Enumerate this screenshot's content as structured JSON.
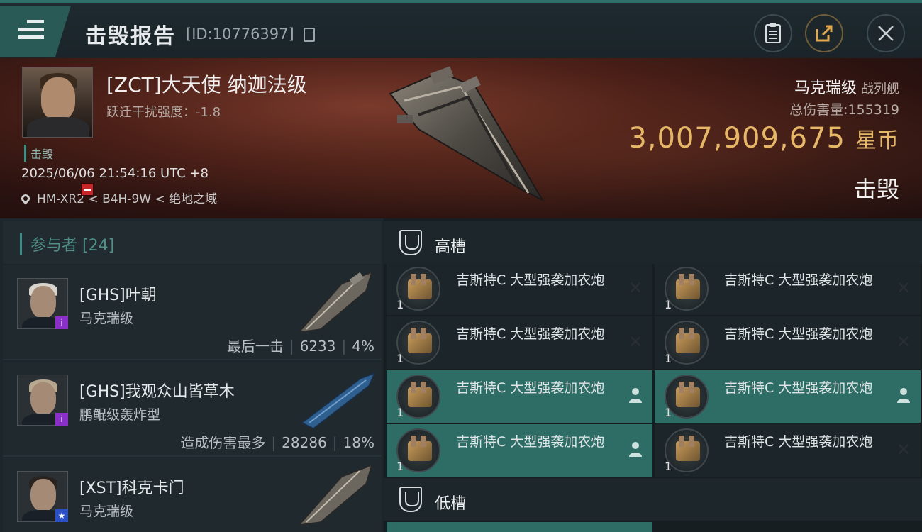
{
  "header": {
    "title": "击毁报告",
    "report_id": "[ID:10776397]"
  },
  "victim": {
    "pilot": "[ZCT]大天使 纳迦法级",
    "warp_strength": "跃迁干扰强度：-1.8",
    "tag": "击毁",
    "datetime": "2025/06/06 21:54:16 UTC +8",
    "location": "HM-XR2 < B4H-9W < 绝地之域",
    "ship_name": "马克瑞级",
    "ship_type": "战列舰",
    "total_damage_label": "总伤害量:",
    "total_damage_value": "155319",
    "isk_value": "3,007,909,675",
    "isk_unit": "星币",
    "status": "击毁"
  },
  "participants": {
    "header": "参与者 [24]",
    "items": [
      {
        "name": "[GHS]叶朝",
        "ship": "马克瑞级",
        "note": "最后一击",
        "damage": "6233",
        "percent": "4%"
      },
      {
        "name": "[GHS]我观众山皆草木",
        "ship": "鹏鲲级轰炸型",
        "note": "造成伤害最多",
        "damage": "28286",
        "percent": "18%"
      },
      {
        "name": "[XST]科克卡门",
        "ship": "马克瑞级"
      }
    ]
  },
  "slots": {
    "high_label": "高槽",
    "low_label": "低槽",
    "modules": [
      {
        "name": "吉斯特C 大型强袭加农炮",
        "qty": "1",
        "status": "destroyed"
      },
      {
        "name": "吉斯特C 大型强袭加农炮",
        "qty": "1",
        "status": "destroyed"
      },
      {
        "name": "吉斯特C 大型强袭加农炮",
        "qty": "1",
        "status": "destroyed"
      },
      {
        "name": "吉斯特C 大型强袭加农炮",
        "qty": "1",
        "status": "destroyed"
      },
      {
        "name": "吉斯特C 大型强袭加农炮",
        "qty": "1",
        "status": "dropped"
      },
      {
        "name": "吉斯特C 大型强袭加农炮",
        "qty": "1",
        "status": "dropped"
      },
      {
        "name": "吉斯特C 大型强袭加农炮",
        "qty": "1",
        "status": "dropped"
      },
      {
        "name": "吉斯特C 大型强袭加农炮",
        "qty": "1",
        "status": "destroyed"
      }
    ]
  },
  "icons": {
    "menu": "menu-icon",
    "copy": "copy-icon",
    "clipboard": "clipboard-icon",
    "share": "share-icon",
    "close": "close-icon",
    "location": "location-pin-icon",
    "slot": "slot-icon",
    "destroyed": "x-icon",
    "dropped": "person-icon"
  },
  "colors": {
    "accent": "#2e6d66",
    "isk": "#e6b766",
    "neg_status": "#c6262a"
  }
}
